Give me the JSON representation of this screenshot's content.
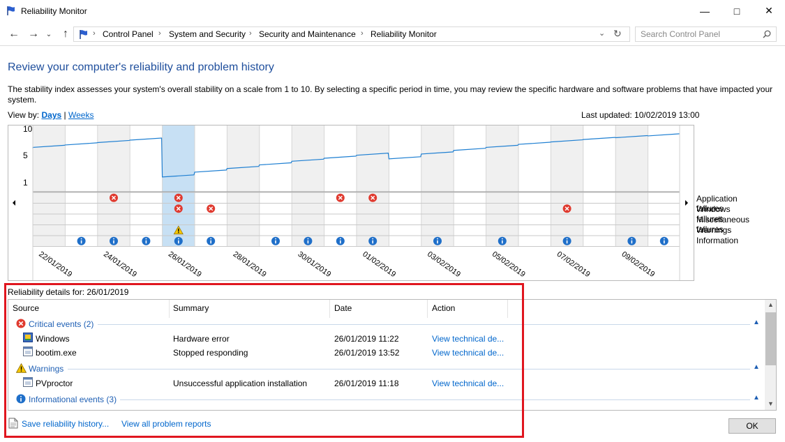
{
  "window": {
    "title": "Reliability Monitor"
  },
  "address": {
    "crumbs": [
      "Control Panel",
      "System and Security",
      "Security and Maintenance",
      "Reliability Monitor"
    ],
    "search_placeholder": "Search Control Panel"
  },
  "page": {
    "title": "Review your computer's reliability and problem history",
    "description": "The stability index assesses your system's overall stability on a scale from 1 to 10. By selecting a specific period in time, you may review the specific hardware and software problems that have impacted your system.",
    "view_by_label": "View by:",
    "view_days": "Days",
    "view_sep": "|",
    "view_weeks": "Weeks",
    "last_updated": "Last updated: 10/02/2019 13:00"
  },
  "chart_data": {
    "type": "line",
    "y_ticks": [
      "10",
      "5",
      "1"
    ],
    "ylim": [
      1,
      10
    ],
    "columns": 20,
    "selected_column": 4,
    "dates": [
      "22/01/2019",
      "24/01/2019",
      "26/01/2019",
      "28/01/2019",
      "30/01/2019",
      "01/02/2019",
      "03/02/2019",
      "05/02/2019",
      "07/02/2019",
      "09/02/2019"
    ],
    "stability_index": [
      7.3,
      7.7,
      8.1,
      8.5,
      2.4,
      3.2,
      3.8,
      4.4,
      5.0,
      5.5,
      6.0,
      5.4,
      6.2,
      6.8,
      7.3,
      7.8,
      8.2,
      8.6,
      8.9,
      9.2
    ],
    "legend": [
      "Application failures",
      "Windows failures",
      "Miscellaneous failures",
      "Warnings",
      "Information"
    ],
    "events": {
      "application_failures": [
        3,
        5,
        10,
        11
      ],
      "windows_failures": [
        5,
        6,
        17
      ],
      "miscellaneous_failures": [],
      "warnings": [
        5
      ],
      "information": [
        2,
        3,
        4,
        5,
        6,
        8,
        9,
        10,
        11,
        13,
        15,
        17,
        19,
        20
      ]
    }
  },
  "details": {
    "title": "Reliability details for: 26/01/2019",
    "columns": [
      "Source",
      "Summary",
      "Date",
      "Action"
    ],
    "groups": [
      {
        "label": "Critical events (2)",
        "icon": "critical-icon",
        "rows": [
          {
            "source": "Windows",
            "summary": "Hardware error",
            "date": "26/01/2019 11:22",
            "action": "View technical de..."
          },
          {
            "source": "bootim.exe",
            "summary": "Stopped responding",
            "date": "26/01/2019 13:52",
            "action": "View technical de..."
          }
        ]
      },
      {
        "label": "Warnings",
        "icon": "warning-icon",
        "rows": [
          {
            "source": "PVproctor",
            "summary": "Unsuccessful application installation",
            "date": "26/01/2019 11:18",
            "action": "View technical de..."
          }
        ]
      },
      {
        "label": "Informational events (3)",
        "icon": "info-icon",
        "rows": []
      }
    ]
  },
  "footer": {
    "save_link": "Save reliability history...",
    "all_link": "View all problem reports",
    "ok": "OK"
  },
  "colors": {
    "accent": "#1e5fb4",
    "highlight": "#c7e0f4",
    "error": "#e74c3c",
    "annotation": "#e0161f"
  }
}
